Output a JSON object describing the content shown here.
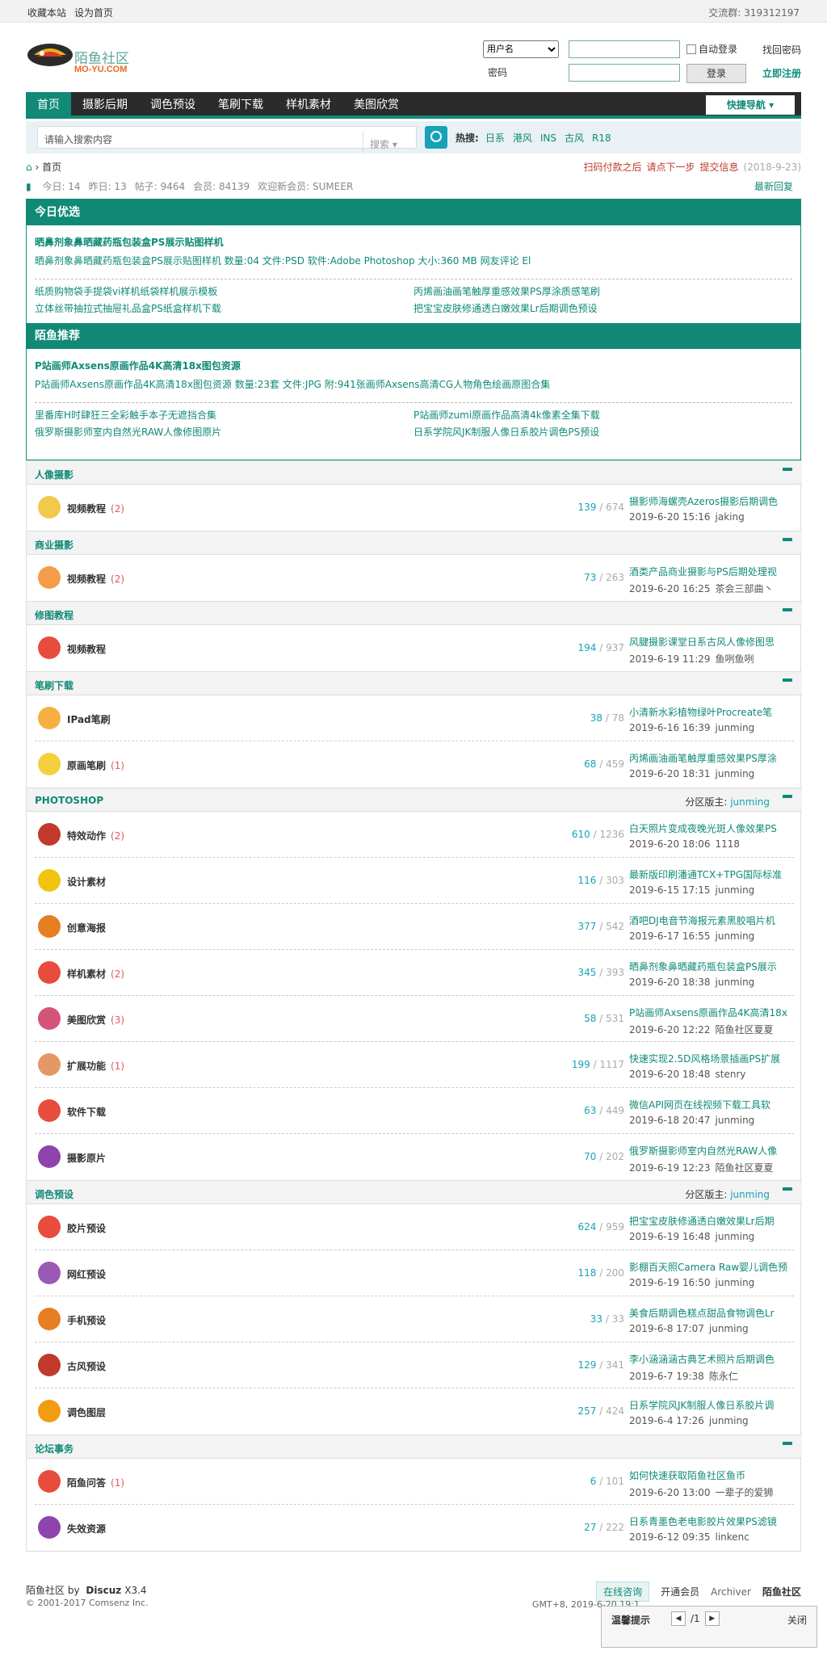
{
  "topbar": {
    "fav": "收藏本站",
    "home": "设为首页",
    "group_label": "交流群:",
    "group_num": "319312197"
  },
  "logo": {
    "cn": "陌鱼社区",
    "en": "MO-YU.COM"
  },
  "login": {
    "user_opt": "用户名",
    "pw_label": "密码",
    "auto": "自动登录",
    "btn": "登录",
    "forgot": "找回密码",
    "reg": "立即注册"
  },
  "nav": {
    "items": [
      "首页",
      "摄影后期",
      "调色预设",
      "笔刷下载",
      "样机素材",
      "美图欣赏"
    ],
    "quick": "快捷导航"
  },
  "search": {
    "placeholder": "请输入搜索内容",
    "type": "搜索",
    "hot_label": "热搜:",
    "hot": [
      "日系",
      "港风",
      "INS",
      "古风",
      "R18"
    ]
  },
  "crumb": {
    "home": "首页",
    "a": "扫码付款之后",
    "b": "请点下一步",
    "c": "提交信息",
    "date": "(2018-9-23)"
  },
  "stats": {
    "today": "今日: 14",
    "yest": "昨日: 13",
    "posts": "帖子: 9464",
    "members": "会员: 84139",
    "welcome": "欢迎新会员: SUMEER",
    "latest": "最新回复"
  },
  "pick": {
    "title": "今日优选",
    "l1": "晒鼻剂象鼻晒藏药瓶包装盒PS展示贴图样机",
    "l2": "晒鼻剂象鼻晒藏药瓶包装盒PS展示贴图样机 数量:04 文件:PSD 软件:Adobe Photoshop 大小:360 MB 网友评论 El",
    "grid": [
      "纸质购物袋手提袋vi样机纸袋样机展示模板",
      "丙烯画油画笔触厚重感效果PS厚涂质感笔刷",
      "立体丝带抽拉式抽屉礼品盒PS纸盒样机下载",
      "把宝宝皮肤修通透白嫩效果Lr后期调色预设"
    ]
  },
  "rec": {
    "title": "陌鱼推荐",
    "l1": "P站画师Axsens原画作品4K高清18x图包资源",
    "l2": "P站画师Axsens原画作品4K高清18x图包资源 数量:23套 文件:JPG 附:941张画师Axsens高清CG人物角色绘画原图合集",
    "grid": [
      "里番库H时肆狂三全彩触手本子无遮挡合集",
      "P站画师zumi原画作品高清4k像素全集下载",
      "俄罗斯摄影师室内自然光RAW人像修图原片",
      "日系学院风JK制服人像日系胶片调色PS预设"
    ]
  },
  "sections": [
    {
      "title": "人像摄影",
      "mod": "",
      "rows": [
        {
          "name": "视频教程",
          "new": "(2)",
          "t": "139",
          "p": "674",
          "lp": "摄影师海螺壳Azeros摄影后期调色",
          "d": "2019-6-20 15:16",
          "u": "jaking",
          "color": "#f2c94c"
        }
      ]
    },
    {
      "title": "商业摄影",
      "mod": "",
      "rows": [
        {
          "name": "视频教程",
          "new": "(2)",
          "t": "73",
          "p": "263",
          "lp": "酒类产品商业摄影与PS后期处理视",
          "d": "2019-6-20 16:25",
          "u": "茶会三部曲丶",
          "color": "#f39c4a"
        }
      ]
    },
    {
      "title": "修图教程",
      "mod": "",
      "rows": [
        {
          "name": "视频教程",
          "new": "",
          "t": "194",
          "p": "937",
          "lp": "风腱摄影课堂日系古风人像修图思",
          "d": "2019-6-19 11:29",
          "u": "鱼咧鱼咧",
          "color": "#e74c3c"
        }
      ]
    },
    {
      "title": "笔刷下载",
      "mod": "",
      "rows": [
        {
          "name": "IPad笔刷",
          "new": "",
          "t": "38",
          "p": "78",
          "lp": "小清新水彩植物绿叶Procreate笔",
          "d": "2019-6-16 16:39",
          "u": "junming",
          "color": "#f5b041"
        },
        {
          "name": "原画笔刷",
          "new": "(1)",
          "t": "68",
          "p": "459",
          "lp": "丙烯画油画笔触厚重感效果PS厚涂",
          "d": "2019-6-20 18:31",
          "u": "junming",
          "color": "#f4d03f"
        }
      ]
    },
    {
      "title": "PHOTOSHOP",
      "mod": "junming",
      "rows": [
        {
          "name": "特效动作",
          "new": "(2)",
          "t": "610",
          "p": "1236",
          "lp": "白天照片变成夜晚光斑人像效果PS",
          "d": "2019-6-20 18:06",
          "u": "1118",
          "color": "#c0392b"
        },
        {
          "name": "设计素材",
          "new": "",
          "t": "116",
          "p": "303",
          "lp": "最新版印刷潘通TCX+TPG国际标准",
          "d": "2019-6-15 17:15",
          "u": "junming",
          "color": "#f1c40f"
        },
        {
          "name": "创意海报",
          "new": "",
          "t": "377",
          "p": "542",
          "lp": "酒吧DJ电音节海报元素黑胶唱片机",
          "d": "2019-6-17 16:55",
          "u": "junming",
          "color": "#e67e22"
        },
        {
          "name": "样机素材",
          "new": "(2)",
          "t": "345",
          "p": "393",
          "lp": "晒鼻剂象鼻晒藏药瓶包装盒PS展示",
          "d": "2019-6-20 18:38",
          "u": "junming",
          "color": "#e74c3c"
        },
        {
          "name": "美图欣赏",
          "new": "(3)",
          "t": "58",
          "p": "531",
          "lp": "P站画师Axsens原画作品4K高清18x",
          "d": "2019-6-20 12:22",
          "u": "陌鱼社区夏夏",
          "color": "#d35477"
        },
        {
          "name": "扩展功能",
          "new": "(1)",
          "t": "199",
          "p": "1117",
          "lp": "快速实现2.5D风格场景插画PS扩展",
          "d": "2019-6-20 18:48",
          "u": "stenry",
          "color": "#e59866"
        },
        {
          "name": "软件下载",
          "new": "",
          "t": "63",
          "p": "449",
          "lp": "微信API网页在线视频下载工具软",
          "d": "2019-6-18 20:47",
          "u": "junming",
          "color": "#e74c3c"
        },
        {
          "name": "摄影原片",
          "new": "",
          "t": "70",
          "p": "202",
          "lp": "俄罗斯摄影师室内自然光RAW人像",
          "d": "2019-6-19 12:23",
          "u": "陌鱼社区夏夏",
          "color": "#8e44ad"
        }
      ]
    },
    {
      "title": "调色预设",
      "mod": "junming",
      "rows": [
        {
          "name": "胶片预设",
          "new": "",
          "t": "624",
          "p": "959",
          "lp": "把宝宝皮肤修通透白嫩效果Lr后期",
          "d": "2019-6-19 16:48",
          "u": "junming",
          "color": "#e74c3c"
        },
        {
          "name": "网红预设",
          "new": "",
          "t": "118",
          "p": "200",
          "lp": "影棚百天照Camera Raw婴儿调色预",
          "d": "2019-6-19 16:50",
          "u": "junming",
          "color": "#9b59b6"
        },
        {
          "name": "手机预设",
          "new": "",
          "t": "33",
          "p": "33",
          "lp": "美食后期调色糕点甜品食物调色Lr",
          "d": "2019-6-8 17:07",
          "u": "junming",
          "color": "#e67e22"
        },
        {
          "name": "古风预设",
          "new": "",
          "t": "129",
          "p": "341",
          "lp": "李小涵涵涵古典艺术照片后期调色",
          "d": "2019-6-7 19:38",
          "u": "陈永仁",
          "color": "#c0392b"
        },
        {
          "name": "调色图层",
          "new": "",
          "t": "257",
          "p": "424",
          "lp": "日系学院风JK制服人像日系胶片调",
          "d": "2019-6-4 17:26",
          "u": "junming",
          "color": "#f39c12"
        }
      ]
    },
    {
      "title": "论坛事务",
      "mod": "",
      "rows": [
        {
          "name": "陌鱼问答",
          "new": "(1)",
          "t": "6",
          "p": "101",
          "lp": "如何快速获取陌鱼社区鱼币",
          "d": "2019-6-20 13:00",
          "u": "一辈子的爱狮",
          "color": "#e74c3c"
        },
        {
          "name": "失效资源",
          "new": "",
          "t": "27",
          "p": "222",
          "lp": "日系青墨色老电影胶片效果PS滤镜",
          "d": "2019-6-12 09:35",
          "u": "linkenc",
          "color": "#8e44ad"
        }
      ]
    }
  ],
  "mod_label": "分区版主:",
  "footer": {
    "site": "陌鱼社区",
    "by": "by",
    "dz": "Discuz",
    "ver": "X3.4",
    "copy": "© 2001-2017 Comsenz Inc.",
    "cs": "在线咨询",
    "vip": "开通会员",
    "arch": "Archiver",
    "brand": "陌鱼社区",
    "time": "GMT+8, 2019-6-20 19:1"
  },
  "tip": {
    "title": "温馨提示",
    "pg": "/1",
    "close": "关闭"
  }
}
